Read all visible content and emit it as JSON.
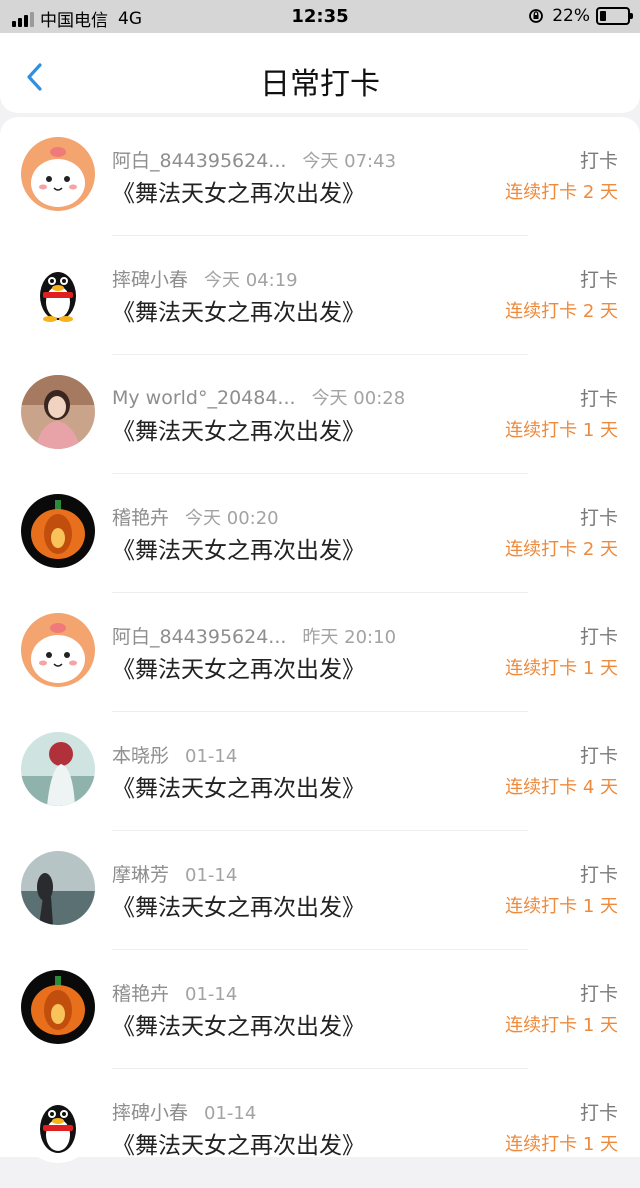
{
  "status_bar": {
    "carrier": "中国电信",
    "network": "4G",
    "time": "12:35",
    "battery": "22%"
  },
  "header": {
    "title": "日常打卡",
    "back_icon": "chevron-left-icon",
    "accent_color": "#2f8fe0"
  },
  "list": {
    "action_color": "#ee8a3c",
    "items": [
      {
        "name": "阿白_844395624...",
        "time": "今天 07:43",
        "book": "《舞法天女之再次出发》",
        "action": "打卡",
        "streak": "连续打卡 2 天",
        "avatar": "cartoon-bunny"
      },
      {
        "name": "摔碑小春",
        "time": "今天 04:19",
        "book": "《舞法天女之再次出发》",
        "action": "打卡",
        "streak": "连续打卡 2 天",
        "avatar": "qq-penguin"
      },
      {
        "name": "My world°_20484...",
        "time": "今天 00:28",
        "book": "《舞法天女之再次出发》",
        "action": "打卡",
        "streak": "连续打卡 1 天",
        "avatar": "photo-girl"
      },
      {
        "name": "稽艳卉",
        "time": "今天 00:20",
        "book": "《舞法天女之再次出发》",
        "action": "打卡",
        "streak": "连续打卡 2 天",
        "avatar": "pumpkin"
      },
      {
        "name": "阿白_844395624...",
        "time": "昨天 20:10",
        "book": "《舞法天女之再次出发》",
        "action": "打卡",
        "streak": "连续打卡 1 天",
        "avatar": "cartoon-bunny"
      },
      {
        "name": "本晓彤",
        "time": "01-14",
        "book": "《舞法天女之再次出发》",
        "action": "打卡",
        "streak": "连续打卡 4 天",
        "avatar": "anime-figure"
      },
      {
        "name": "摩琳芳",
        "time": "01-14",
        "book": "《舞法天女之再次出发》",
        "action": "打卡",
        "streak": "连续打卡 1 天",
        "avatar": "photo-landscape"
      },
      {
        "name": "稽艳卉",
        "time": "01-14",
        "book": "《舞法天女之再次出发》",
        "action": "打卡",
        "streak": "连续打卡 1 天",
        "avatar": "pumpkin"
      },
      {
        "name": "摔碑小春",
        "time": "01-14",
        "book": "《舞法天女之再次出发》",
        "action": "打卡",
        "streak": "连续打卡 1 天",
        "avatar": "qq-penguin"
      }
    ]
  }
}
